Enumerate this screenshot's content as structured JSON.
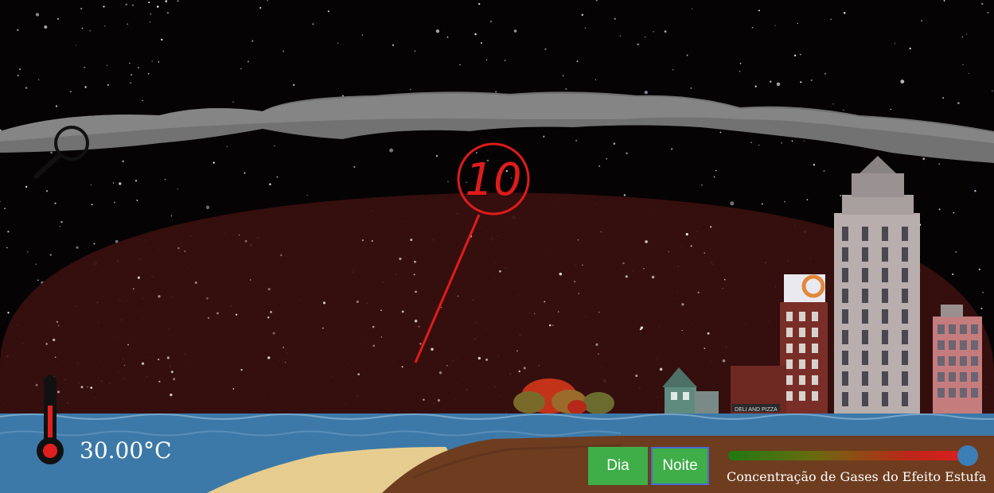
{
  "temperature": {
    "value_text": "30.00°C"
  },
  "counter": {
    "value": "10"
  },
  "buttons": {
    "day_label": "Dia",
    "night_label": "Noite"
  },
  "slider": {
    "label": "Concentração de Gases do Efeito Estufa",
    "value_fraction": 0.97
  },
  "billboard": {
    "text": "DELI AND PIZZA"
  },
  "colors": {
    "button_green": "#3fae49",
    "button_active_border": "#4a6ad0",
    "counter_red": "#e01b1b",
    "atmosphere": "#3a0f0f",
    "water": "#3d79a8",
    "slider_thumb": "#3b7fb6"
  },
  "icons": {
    "magnifier": "magnifier-icon",
    "thermometer": "thermometer-icon"
  }
}
